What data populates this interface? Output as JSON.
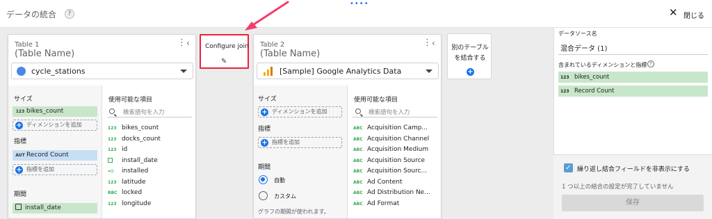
{
  "header": {
    "title": "データの統合",
    "help_icon": "?",
    "drag_handle": "••••",
    "close_icon": "✕",
    "close_label": "閉じる"
  },
  "table1": {
    "label": "Table 1",
    "name": "(Table Name)",
    "data_source": "cycle_stations",
    "dimensions_label": "サイズ",
    "dimension_chip": {
      "type": "123",
      "name": "bikes_count"
    },
    "add_dimension": "ディメンションを追加",
    "metrics_label": "指標",
    "metric_chip": {
      "type": "AUT",
      "name": "Record Count"
    },
    "add_metric": "指標を追加",
    "period_label": "期間",
    "period_chip": "install_date",
    "available_header": "使用可能な項目",
    "search_placeholder": "検索語句を入力",
    "fields": [
      {
        "type": "123",
        "name": "bikes_count"
      },
      {
        "type": "123",
        "name": "docks_count"
      },
      {
        "type": "123",
        "name": "id"
      },
      {
        "type": "cal",
        "name": "install_date"
      },
      {
        "type": "=|-",
        "name": "installed"
      },
      {
        "type": "123",
        "name": "latitude"
      },
      {
        "type": "RBC",
        "name": "locked"
      },
      {
        "type": "123",
        "name": "longitude"
      }
    ]
  },
  "configure_join": {
    "label": "Configure join",
    "pencil_icon": "✎"
  },
  "table2": {
    "label": "Table 2",
    "name": "(Table Name)",
    "data_source": "[Sample] Google Analytics Data",
    "dimensions_label": "サイズ",
    "add_dimension": "ディメンションを追加",
    "metrics_label": "指標",
    "add_metric": "指標を追加",
    "period_label": "期間",
    "radio_auto": "自動",
    "radio_custom": "カスタム",
    "period_note": "グラフの期間が使われます。",
    "available_header": "使用可能な項目",
    "search_placeholder": "検索語句を入力",
    "fields": [
      {
        "type": "ABC",
        "name": "Acquisition Camp..."
      },
      {
        "type": "ABC",
        "name": "Acquisition Channel"
      },
      {
        "type": "ABC",
        "name": "Acquisition Medium"
      },
      {
        "type": "ABC",
        "name": "Acquisition Source"
      },
      {
        "type": "ABC",
        "name": "Acquisition Sourc..."
      },
      {
        "type": "ABC",
        "name": "Ad Content"
      },
      {
        "type": "ABC",
        "name": "Ad Distribution Ne..."
      },
      {
        "type": "ABC",
        "name": "Ad Format"
      }
    ]
  },
  "add_table": {
    "line1": "別のテーブル",
    "line2": "を結合する"
  },
  "sidepanel": {
    "source_label": "データソース名",
    "source_value": "混合データ (1)",
    "included_label": "含まれているディメンションと指標",
    "included": [
      {
        "type": "123",
        "name": "bikes_count"
      },
      {
        "type": "123",
        "name": "Record Count"
      }
    ],
    "hide_repeated": "繰り返し結合フィールドを非表示にする",
    "incomplete_msg": "1 つ以上の結合の設定が完了していません",
    "save": "保存"
  },
  "colors": {
    "accent": "#1a73e8",
    "highlight_border": "#e8233c",
    "dimension_chip": "#c8e6c9",
    "metric_chip": "#c6dff5"
  }
}
